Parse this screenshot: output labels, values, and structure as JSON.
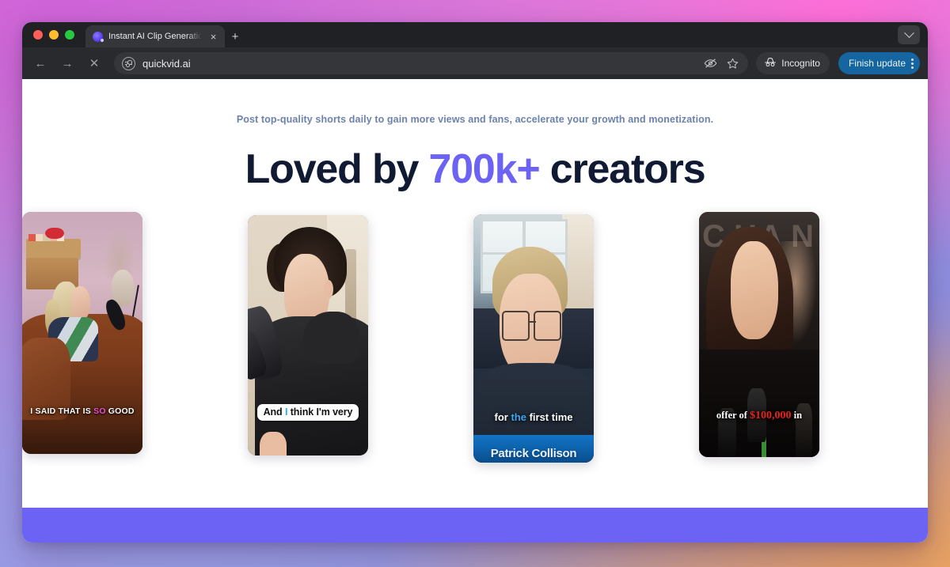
{
  "browser": {
    "traffic_lights": [
      "close",
      "minimize",
      "maximize"
    ],
    "tab": {
      "title": "Instant AI Clip Generation | Qu",
      "favicon": "quickvid-favicon",
      "close_label": "×"
    },
    "new_tab_label": "+",
    "tab_list_icon": "chevron-down-icon",
    "toolbar": {
      "back_label": "←",
      "forward_label": "→",
      "stop_label": "✕",
      "url": "quickvid.ai",
      "site_info_icon": "tune-icon",
      "hide_password_icon": "eye-slash-icon",
      "bookmark_icon": "star-icon",
      "incognito_label": "Incognito",
      "incognito_icon": "incognito-hat-icon",
      "update_label": "Finish update",
      "menu_icon": "kebab-menu-icon"
    }
  },
  "page": {
    "subtitle": "Post top-quality shorts daily to gain more views and fans, accelerate your growth and monetization.",
    "headline": {
      "before": "Loved by ",
      "accent": "700k+",
      "after": " creators"
    },
    "accent_color": "#6c63f5",
    "subtitle_color": "#6d82ab",
    "headline_color": "#101a33",
    "footer_band_color": "#6c63f5",
    "cards": [
      {
        "name": "clip-card-1",
        "scene": "podcast interview, blonde woman in orange armchair, pink wall",
        "caption": {
          "before": "I SAID THAT IS ",
          "highlight": "SO",
          "after": " GOOD"
        },
        "highlight_color": "#ef4fd0",
        "style": "outlined-white-uppercase"
      },
      {
        "name": "clip-card-2",
        "scene": "man with curly dark hair in black hoodie at microphone",
        "caption": {
          "before": "And ",
          "highlight": "I",
          "after": " think I'm very"
        },
        "highlight_color": "#2aa7ef",
        "style": "white-pill"
      },
      {
        "name": "clip-card-3",
        "scene": "blond man with glasses in navy shirt, window behind",
        "caption": {
          "before": "for ",
          "highlight": "the",
          "after": " first time"
        },
        "highlight_color": "#3ea8f0",
        "style": "white-bold",
        "banner_text": "Patrick Collison",
        "banner_color": "#0d5ea6"
      },
      {
        "name": "clip-card-4",
        "scene": "woman with long dark hair speaking at press microphones",
        "caption": {
          "before": "offer of ",
          "highlight": "$100,000",
          "after": " in"
        },
        "highlight_color": "#e8221b",
        "style": "serif-white"
      }
    ]
  }
}
